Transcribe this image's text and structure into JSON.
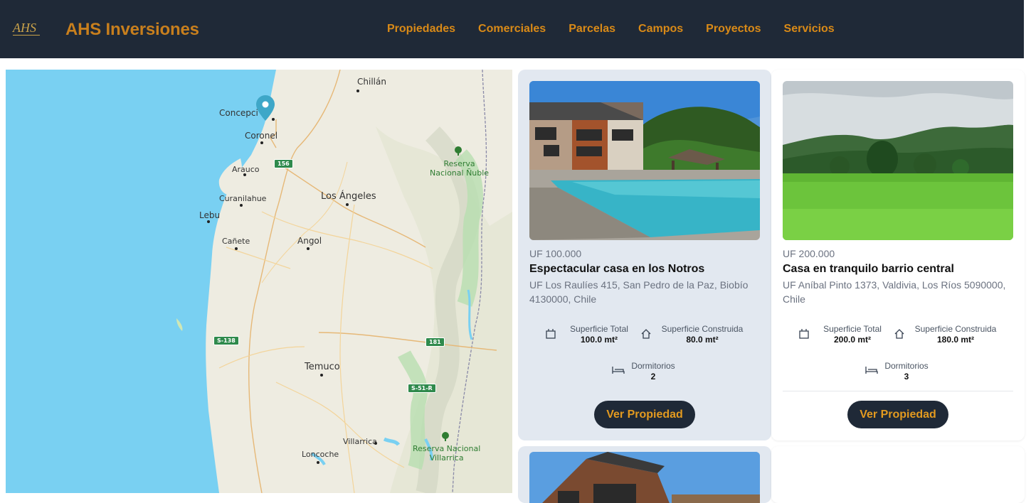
{
  "header": {
    "brand": "AHS Inversiones",
    "nav": [
      "Propiedades",
      "Comerciales",
      "Parcelas",
      "Campos",
      "Proyectos",
      "Servicios"
    ]
  },
  "map": {
    "labels": {
      "chillan": "Chillán",
      "concepcion": "Concepci",
      "coronel": "Coronel",
      "arauco": "Arauco",
      "curanilahue": "Curanilahue",
      "lebu": "Lebu",
      "canete": "Cañete",
      "angol": "Angol",
      "los_angeles": "Los Ángeles",
      "temuco": "Temuco",
      "loncoche": "Loncoche",
      "villarrica": "Villarrica",
      "reserva_nuble": "Reserva\nNacional Ñuble",
      "reserva_villarrica": "Reserva Nacional\nVillarrica"
    },
    "routes": {
      "r156": "156",
      "r181": "181",
      "rs138": "S-138",
      "rs51r": "S-51-R"
    }
  },
  "listings": [
    {
      "price": "UF 100.000",
      "title": "Espectacular casa en los Notros",
      "address": "UF Los Raulíes 415, San Pedro de la Paz, Biobío 4130000, Chile",
      "sup_total_label": "Superficie Total",
      "sup_total": "100.0 mt²",
      "sup_const_label": "Superficie Construida",
      "sup_const": "80.0 mt²",
      "dorm_label": "Dormitorios",
      "dorm": "2",
      "button": "Ver Propiedad"
    },
    {
      "price": "UF 200.000",
      "title": "Casa en tranquilo barrio central",
      "address": "UF Aníbal Pinto 1373, Valdivia, Los Ríos 5090000, Chile",
      "sup_total_label": "Superficie Total",
      "sup_total": "200.0 mt²",
      "sup_const_label": "Superficie Construida",
      "sup_const": "180.0 mt²",
      "dorm_label": "Dormitorios",
      "dorm": "3",
      "button": "Ver Propiedad"
    }
  ],
  "colors": {
    "navbar": "#1f2937",
    "accent": "#d98a17",
    "card_highlight": "#e2e8f0",
    "sea": "#79d0f2",
    "land": "#eeece1"
  }
}
